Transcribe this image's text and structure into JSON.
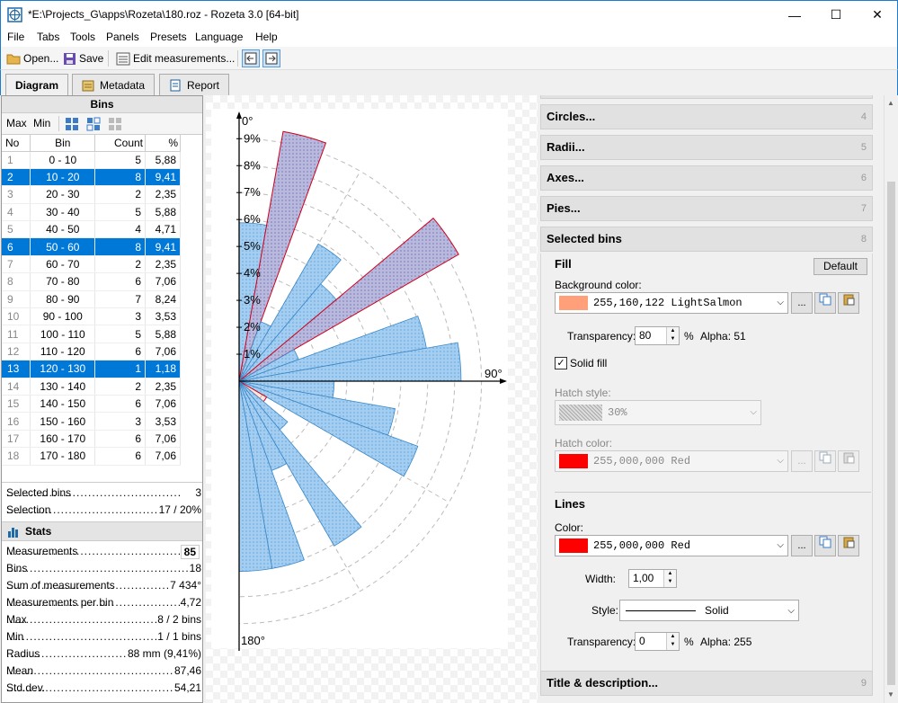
{
  "window": {
    "title": "*E:\\Projects_G\\apps\\Rozeta\\180.roz - Rozeta 3.0  [64-bit]",
    "minimize": "—",
    "maximize": "☐",
    "close": "✕"
  },
  "menu": [
    "File",
    "Tabs",
    "Tools",
    "Panels",
    "Presets",
    "Language",
    "Help"
  ],
  "toolbar": {
    "open": "Open...",
    "save": "Save",
    "edit": "Edit measurements..."
  },
  "tabs": [
    {
      "label": "Diagram"
    },
    {
      "label": "Metadata"
    },
    {
      "label": "Report"
    }
  ],
  "bins": {
    "header": "Bins",
    "max": "Max",
    "min": "Min",
    "columns": [
      "No",
      "Bin",
      "Count",
      "%"
    ],
    "rows": [
      {
        "no": "1",
        "bin": "0 - 10",
        "count": "5",
        "pct": "5,88",
        "selected": false
      },
      {
        "no": "2",
        "bin": "10 - 20",
        "count": "8",
        "pct": "9,41",
        "selected": true
      },
      {
        "no": "3",
        "bin": "20 - 30",
        "count": "2",
        "pct": "2,35",
        "selected": false
      },
      {
        "no": "4",
        "bin": "30 - 40",
        "count": "5",
        "pct": "5,88",
        "selected": false
      },
      {
        "no": "5",
        "bin": "40 - 50",
        "count": "4",
        "pct": "4,71",
        "selected": false
      },
      {
        "no": "6",
        "bin": "50 - 60",
        "count": "8",
        "pct": "9,41",
        "selected": true
      },
      {
        "no": "7",
        "bin": "60 - 70",
        "count": "2",
        "pct": "2,35",
        "selected": false
      },
      {
        "no": "8",
        "bin": "70 - 80",
        "count": "6",
        "pct": "7,06",
        "selected": false
      },
      {
        "no": "9",
        "bin": "80 - 90",
        "count": "7",
        "pct": "8,24",
        "selected": false
      },
      {
        "no": "10",
        "bin": "90 - 100",
        "count": "3",
        "pct": "3,53",
        "selected": false
      },
      {
        "no": "11",
        "bin": "100 - 110",
        "count": "5",
        "pct": "5,88",
        "selected": false
      },
      {
        "no": "12",
        "bin": "110 - 120",
        "count": "6",
        "pct": "7,06",
        "selected": false
      },
      {
        "no": "13",
        "bin": "120 - 130",
        "count": "1",
        "pct": "1,18",
        "selected": true
      },
      {
        "no": "14",
        "bin": "130 - 140",
        "count": "2",
        "pct": "2,35",
        "selected": false
      },
      {
        "no": "15",
        "bin": "140 - 150",
        "count": "6",
        "pct": "7,06",
        "selected": false
      },
      {
        "no": "16",
        "bin": "150 - 160",
        "count": "3",
        "pct": "3,53",
        "selected": false
      },
      {
        "no": "17",
        "bin": "160 - 170",
        "count": "6",
        "pct": "7,06",
        "selected": false
      },
      {
        "no": "18",
        "bin": "170 - 180",
        "count": "6",
        "pct": "7,06",
        "selected": false
      }
    ],
    "selected_bins_label": "Selected bins",
    "selected_bins_value": "3",
    "selection_label": "Selection",
    "selection_value": "17 / 20%"
  },
  "stats": {
    "header": "Stats",
    "rows": [
      {
        "label": "Measurements",
        "value": "85"
      },
      {
        "label": "Bins",
        "value": "18"
      },
      {
        "label": "Sum of measurements",
        "value": "7 434°"
      },
      {
        "label": "Measurements per bin",
        "value": "4,72"
      },
      {
        "label": "Max",
        "value": "8 / 2 bins"
      },
      {
        "label": "Min",
        "value": "1 / 1 bins"
      },
      {
        "label": "Radius",
        "value": "88 mm (9,41%)"
      },
      {
        "label": "Mean",
        "value": "87,46"
      },
      {
        "label": "Std.dev.",
        "value": "54,21"
      }
    ]
  },
  "diagram": {
    "top_label": "0°",
    "bottom_label": "180°",
    "right_label": "90°",
    "ring_labels": [
      "1%",
      "2%",
      "3%",
      "4%",
      "5%",
      "6%",
      "7%",
      "8%",
      "9%"
    ],
    "fill_color": "#9ecbf0",
    "selected_line_color": "#d1001c",
    "selected_fill_color": "#ffa07a"
  },
  "chart_data": {
    "type": "rose",
    "categories": [
      "0 - 10",
      "10 - 20",
      "20 - 30",
      "30 - 40",
      "40 - 50",
      "50 - 60",
      "60 - 70",
      "70 - 80",
      "80 - 90",
      "90 - 100",
      "100 - 110",
      "110 - 120",
      "120 - 130",
      "130 - 140",
      "140 - 150",
      "150 - 160",
      "160 - 170",
      "170 - 180"
    ],
    "values": [
      5.88,
      9.41,
      2.35,
      5.88,
      4.71,
      9.41,
      2.35,
      7.06,
      8.24,
      3.53,
      5.88,
      7.06,
      1.18,
      2.35,
      7.06,
      3.53,
      7.06,
      7.06
    ],
    "selected": [
      false,
      true,
      false,
      false,
      false,
      true,
      false,
      false,
      false,
      false,
      false,
      false,
      true,
      false,
      false,
      false,
      false,
      false
    ],
    "ylim": [
      0,
      9.41
    ]
  },
  "right": {
    "sections_top": [
      {
        "label": "Circles...",
        "num": "4"
      },
      {
        "label": "Radii...",
        "num": "5"
      },
      {
        "label": "Axes...",
        "num": "6"
      },
      {
        "label": "Pies...",
        "num": "7"
      },
      {
        "label": "Selected bins",
        "num": "8"
      }
    ],
    "fill": {
      "title": "Fill",
      "default": "Default",
      "bg_label": "Background color:",
      "bg_value": "255,160,122  LightSalmon",
      "bg_color": "#ffa07a",
      "transparency_label": "Transparency:",
      "transparency_value": "80",
      "pct": "%",
      "alpha": "Alpha: 51",
      "solid_fill": "Solid fill",
      "hatch_style_label": "Hatch style:",
      "hatch_style_value": "30%",
      "hatch_color_label": "Hatch color:",
      "hatch_color_value": "255,000,000  Red",
      "hatch_color": "#ff0000"
    },
    "lines": {
      "title": "Lines",
      "color_label": "Color:",
      "color_value": "255,000,000  Red",
      "color": "#ff0000",
      "width_label": "Width:",
      "width_value": "1,00",
      "style_label": "Style:",
      "style_value": "Solid",
      "transparency_label": "Transparency:",
      "transparency_value": "0",
      "pct": "%",
      "alpha": "Alpha: 255"
    },
    "ellipsis": "...",
    "bottom_section": {
      "label": "Title & description...",
      "num": "9"
    }
  }
}
